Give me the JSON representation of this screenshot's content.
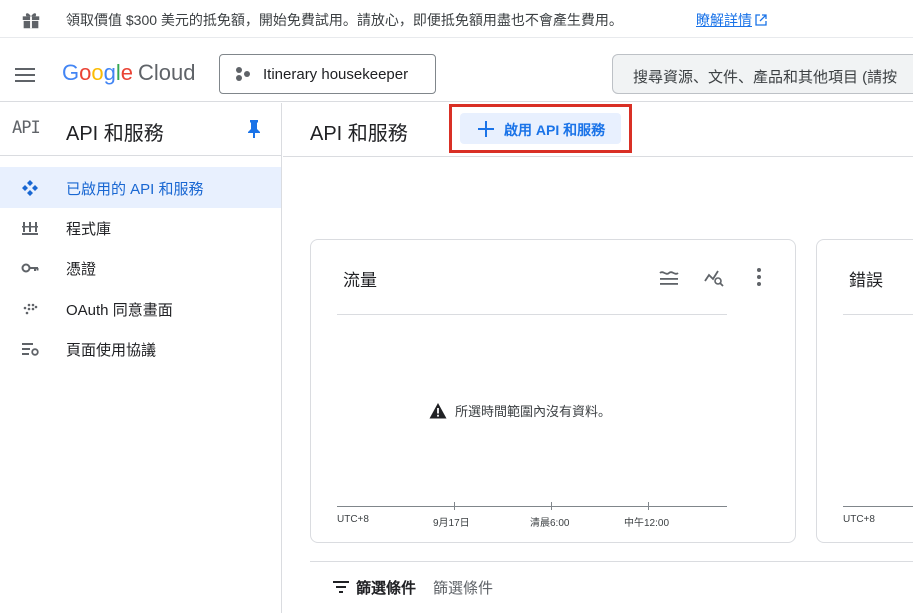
{
  "promo": {
    "text": "領取價值 $300 美元的抵免額，開始免費試用。請放心，即便抵免額用盡也不會產生費用。",
    "link": "瞭解詳情"
  },
  "header": {
    "logo": {
      "g1": "G",
      "o1": "o",
      "o2": "o",
      "g2": "g",
      "l": "l",
      "e": "e",
      "cloud": "Cloud"
    },
    "project": "Itinerary housekeeper",
    "search_placeholder": "搜尋資源、文件、產品和其他項目 (請按"
  },
  "sidebar": {
    "badge": "API",
    "title": "API 和服務",
    "items": [
      {
        "label": "已啟用的 API 和服務",
        "icon": "enabled-apis-icon",
        "active": true
      },
      {
        "label": "程式庫",
        "icon": "library-icon"
      },
      {
        "label": "憑證",
        "icon": "key-icon"
      },
      {
        "label": "OAuth 同意畫面",
        "icon": "oauth-icon"
      },
      {
        "label": "頁面使用協議",
        "icon": "page-usage-icon"
      }
    ]
  },
  "main": {
    "title": "API 和服務",
    "enable_button": "啟用 API 和服務",
    "traffic_card": {
      "title": "流量",
      "empty_message": "所選時間範圍內沒有資料。",
      "x_ticks": [
        "UTC+8",
        "9月17日",
        "清晨6:00",
        "中午12:00"
      ]
    },
    "errors_card": {
      "title": "錯誤",
      "x_ticks": [
        "UTC+8"
      ]
    },
    "filter": {
      "label": "篩選條件",
      "placeholder": "篩選條件"
    }
  },
  "colors": {
    "accent": "#1a73e8",
    "highlight": "#d93025",
    "active_bg": "#e8f0fe"
  }
}
